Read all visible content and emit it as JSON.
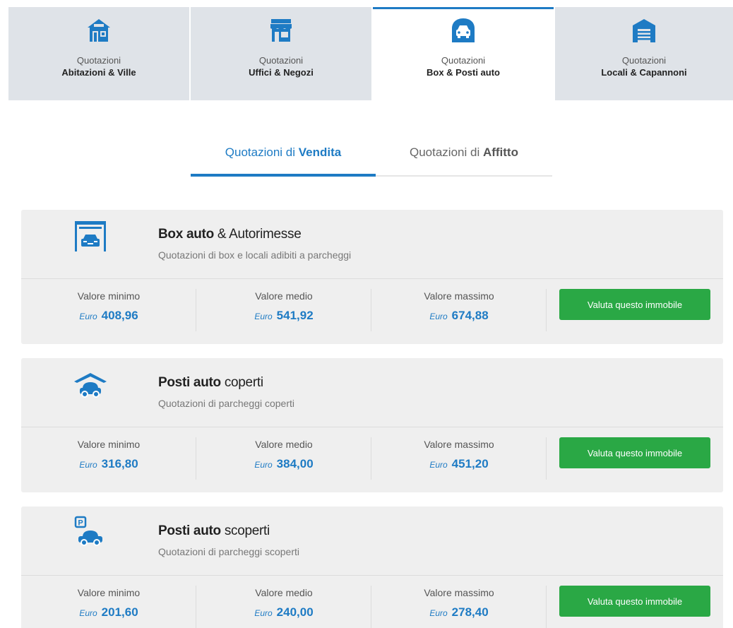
{
  "category_tabs": [
    {
      "line1": "Quotazioni",
      "line2": "Abitazioni & Ville",
      "icon": "house-icon",
      "active": false
    },
    {
      "line1": "Quotazioni",
      "line2": "Uffici & Negozi",
      "icon": "shop-icon",
      "active": false
    },
    {
      "line1": "Quotazioni",
      "line2": "Box & Posti auto",
      "icon": "garage-car-icon",
      "active": true
    },
    {
      "line1": "Quotazioni",
      "line2": "Locali & Capannoni",
      "icon": "warehouse-icon",
      "active": false
    }
  ],
  "sub_tabs": [
    {
      "prefix": "Quotazioni di ",
      "bold": "Vendita",
      "active": true
    },
    {
      "prefix": "Quotazioni di ",
      "bold": "Affitto",
      "active": false
    }
  ],
  "labels": {
    "min": "Valore minimo",
    "avg": "Valore medio",
    "max": "Valore massimo",
    "currency": "Euro",
    "button": "Valuta questo immobile"
  },
  "cards": [
    {
      "title_bold": "Box auto",
      "title_rest": " & Autorimesse",
      "subtitle": "Quotazioni di box e locali adibiti a parcheggi",
      "icon": "box-garage-icon",
      "min": "408,96",
      "avg": "541,92",
      "max": "674,88"
    },
    {
      "title_bold": "Posti auto",
      "title_rest": " coperti",
      "subtitle": "Quotazioni di parcheggi coperti",
      "icon": "covered-parking-icon",
      "min": "316,80",
      "avg": "384,00",
      "max": "451,20"
    },
    {
      "title_bold": "Posti auto",
      "title_rest": " scoperti",
      "subtitle": "Quotazioni di parcheggi scoperti",
      "icon": "open-parking-icon",
      "min": "201,60",
      "avg": "240,00",
      "max": "278,40"
    }
  ],
  "colors": {
    "accent": "#1e7bc4",
    "button": "#2aa845",
    "tab_bg": "#dfe3e8",
    "card_bg": "#efefef"
  }
}
